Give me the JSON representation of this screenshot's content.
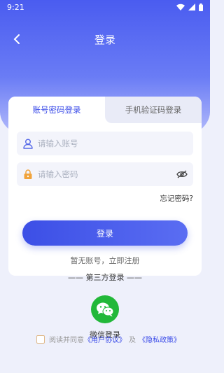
{
  "status": {
    "time": "9:21"
  },
  "nav": {
    "title": "登录"
  },
  "tabs": [
    {
      "label": "账号密码登录",
      "active": true
    },
    {
      "label": "手机验证码登录",
      "active": false
    }
  ],
  "form": {
    "account_placeholder": "请输入账号",
    "password_placeholder": "请输入密码",
    "forgot_label": "忘记密码?",
    "login_label": "登录",
    "register_label": "暂无账号，立即注册"
  },
  "third_party": {
    "title": "—— 第三方登录 ——",
    "wechat_label": "微信登录"
  },
  "agreement": {
    "prefix": "阅读并同意",
    "user_agreement": "《用户协议》",
    "and": "及",
    "privacy_policy": "《隐私政策》"
  },
  "colors": {
    "primary": "#3a4be8",
    "wechat": "#22b839",
    "header_gradient_top": "#4a5cf0"
  }
}
